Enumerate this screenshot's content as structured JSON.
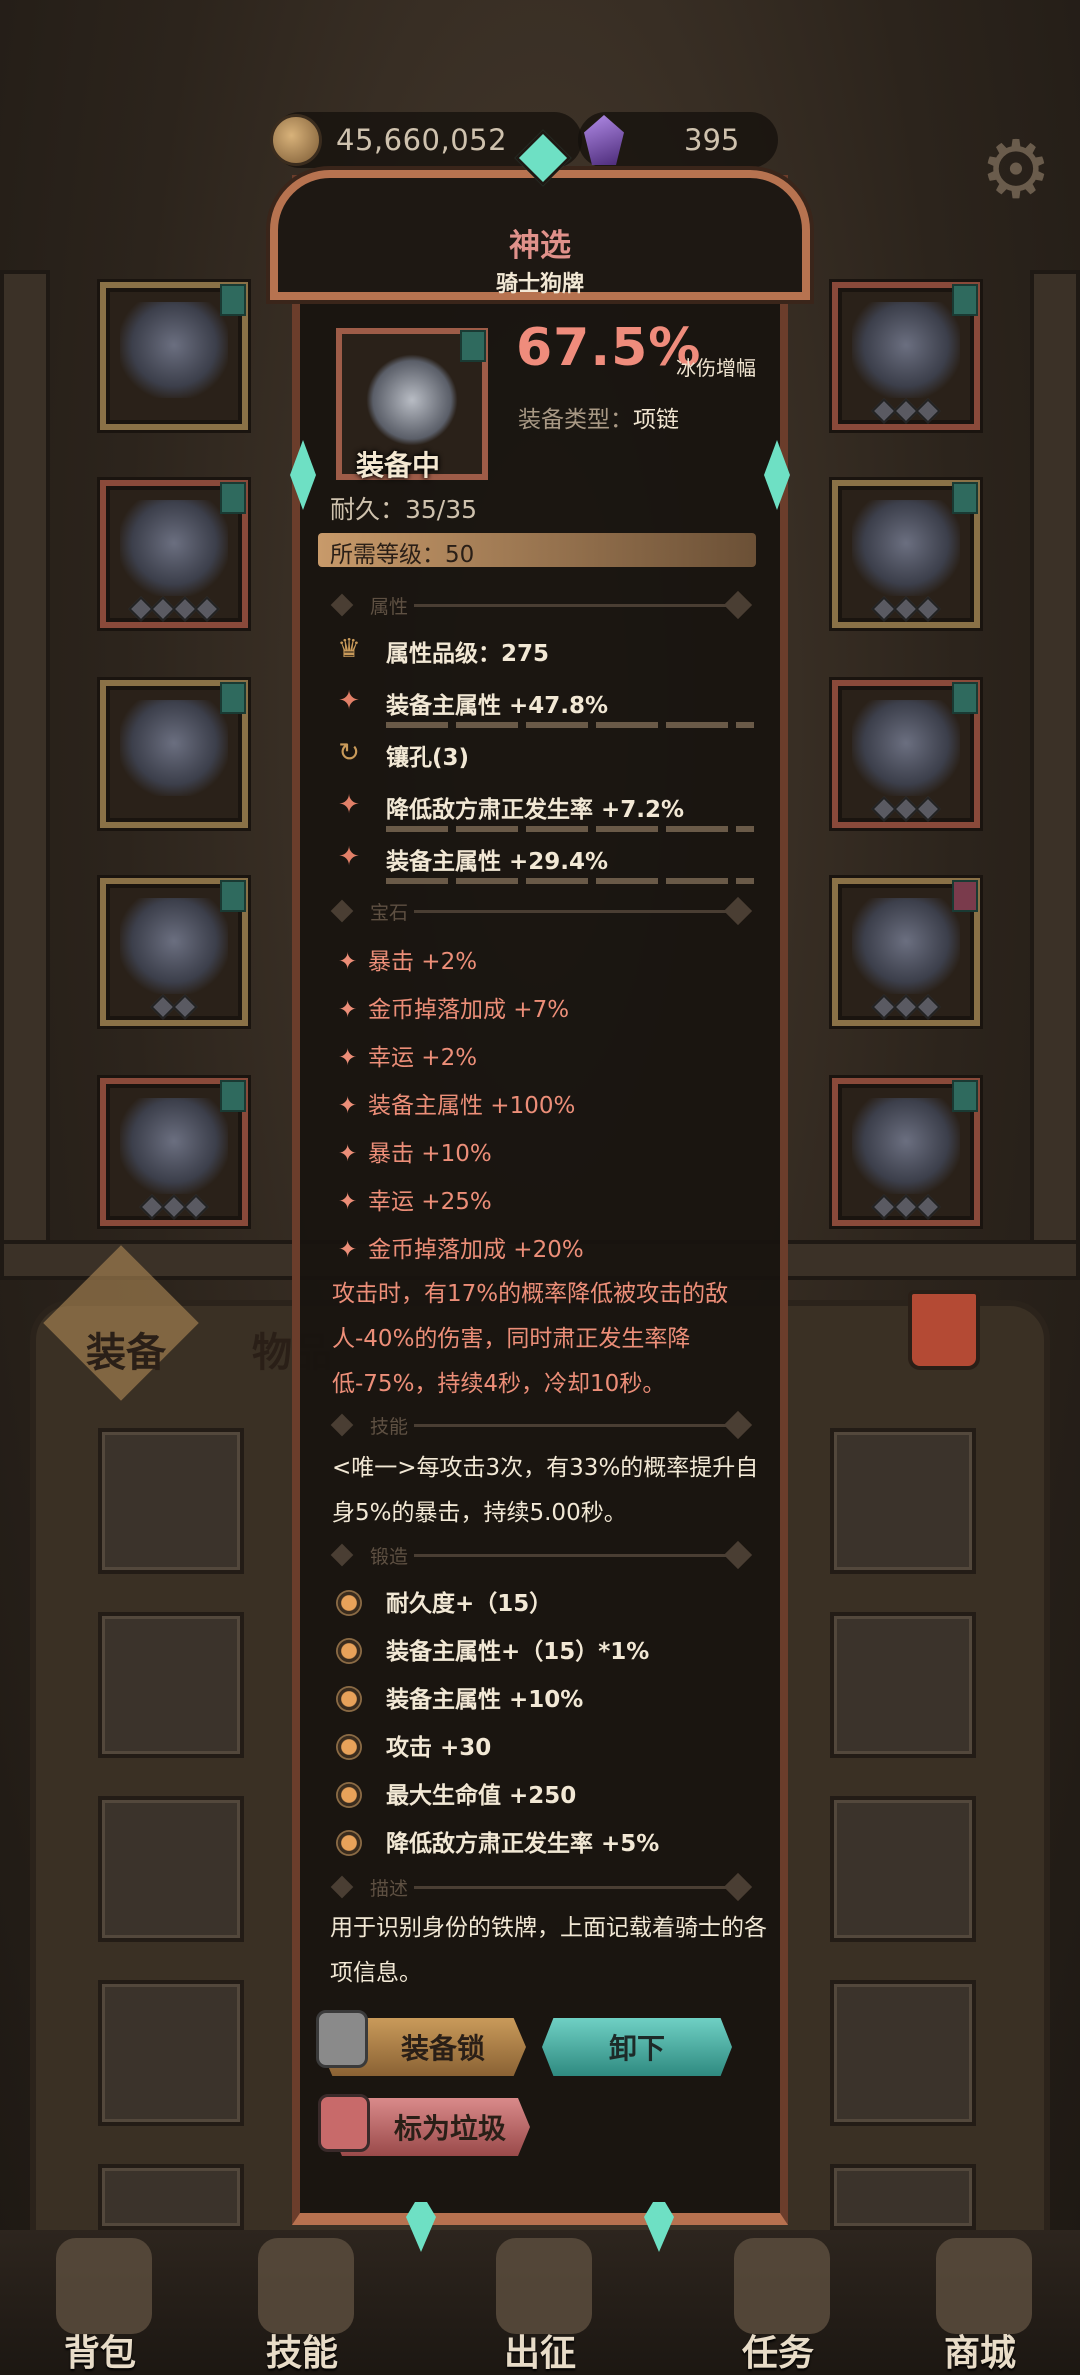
{
  "currency": {
    "coins": "45,660,052",
    "gems": "395"
  },
  "icons": {
    "settings": "gear-icon"
  },
  "item": {
    "quality": "神选",
    "name": "骑士狗牌",
    "equipped_label": "装备中",
    "stat_value": "67.5%",
    "stat_label": "冰伤增幅",
    "type_label": "装备类型：",
    "type_value": "项链",
    "durability": "耐久：35/35",
    "required_level": "所需等级：50"
  },
  "sections": {
    "attributes": "属性",
    "gems": "宝石",
    "skills": "技能",
    "forge": "锻造",
    "description": "描述"
  },
  "attributes": [
    {
      "icon": "crown-icon",
      "text": "属性品级：275"
    },
    {
      "icon": "spark-icon",
      "text": "装备主属性 +47.8%"
    },
    {
      "icon": "refresh-icon",
      "text": "镶孔(3)"
    },
    {
      "icon": "spark-icon",
      "text": "降低敌方肃正发生率 +7.2%"
    },
    {
      "icon": "spark-icon",
      "text": "装备主属性 +29.4%"
    }
  ],
  "gem_bonuses": [
    "暴击 +2%",
    "金币掉落加成 +7%",
    "幸运 +2%",
    "装备主属性 +100%",
    "暴击 +10%",
    "幸运 +25%",
    "金币掉落加成 +20%"
  ],
  "set_effect": "攻击时，有17%的概率降低被攻击的敌人-40%的伤害，同时肃正发生率降低-75%，持续4秒，冷却10秒。",
  "skill": "<唯一>每攻击3次，有33%的概率提升自身5%的暴击，持续5.00秒。",
  "forge_stats": [
    "耐久度+（15）",
    "装备主属性+（15）*1%",
    "装备主属性 +10%",
    "攻击 +30",
    "最大生命值 +250",
    "降低敌方肃正发生率 +5%"
  ],
  "description": "用于识别身份的铁牌，上面记载着骑士的各项信息。",
  "buttons": {
    "lock": "装备锁",
    "unload": "卸下",
    "junk": "标为垃圾"
  },
  "bag_tabs": [
    "装备",
    "物品"
  ],
  "nav": [
    "背包",
    "技能",
    "出征",
    "任务",
    "商城"
  ],
  "colors": {
    "quality": "#e0918a",
    "accent_red": "#ec8e78",
    "accent_teal": "#6ee0c4",
    "gold": "#c99a5a"
  }
}
